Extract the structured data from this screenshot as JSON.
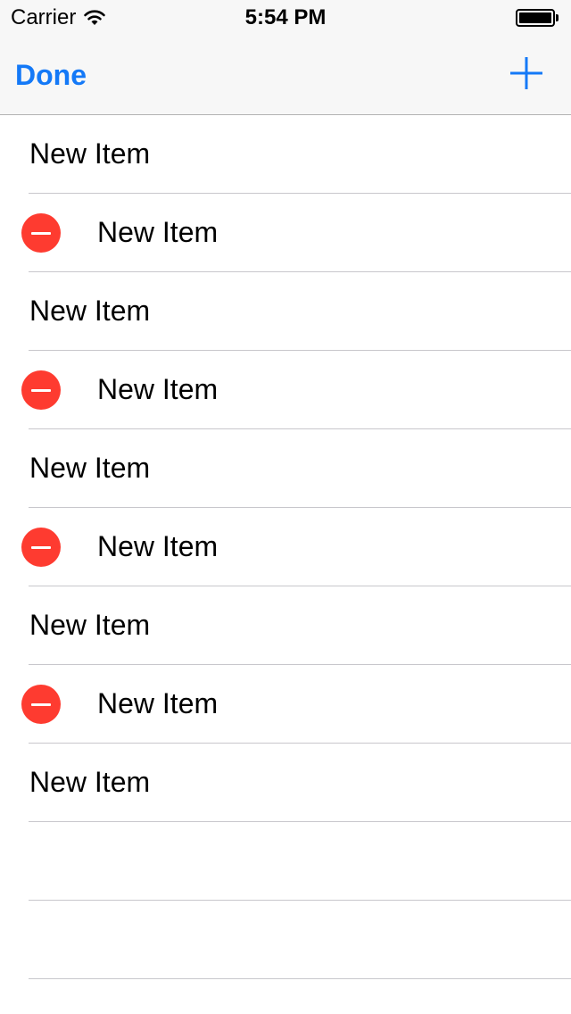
{
  "status_bar": {
    "carrier": "Carrier",
    "time": "5:54 PM"
  },
  "nav": {
    "done_label": "Done",
    "add_icon": "plus-icon",
    "tint_color": "#1479f7"
  },
  "table": {
    "delete_color": "#fe3b30",
    "rows": [
      {
        "label": "New Item",
        "deletable": false
      },
      {
        "label": "New Item",
        "deletable": true
      },
      {
        "label": "New Item",
        "deletable": false
      },
      {
        "label": "New Item",
        "deletable": true
      },
      {
        "label": "New Item",
        "deletable": false
      },
      {
        "label": "New Item",
        "deletable": true
      },
      {
        "label": "New Item",
        "deletable": false
      },
      {
        "label": "New Item",
        "deletable": true
      },
      {
        "label": "New Item",
        "deletable": false
      },
      {
        "label": "",
        "deletable": false
      },
      {
        "label": "",
        "deletable": false
      }
    ]
  }
}
